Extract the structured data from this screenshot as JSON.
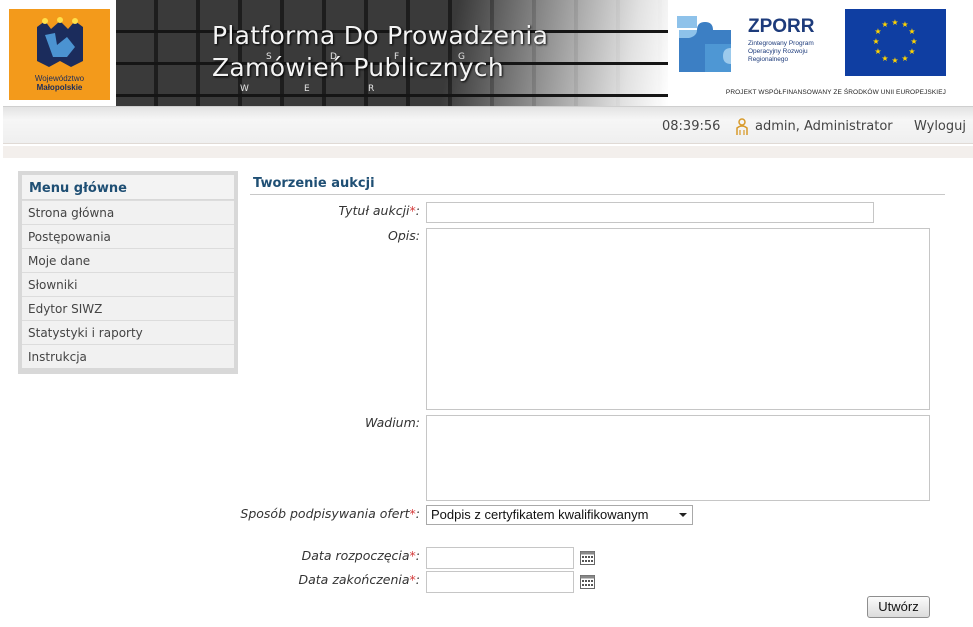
{
  "header": {
    "region_logo_line1": "Województwo",
    "region_logo_line2": "Małopolskie",
    "title_line1": "Platforma Do Prowadzenia",
    "title_line2": "Zamówień Publicznych",
    "zporr_name": "ZPORR",
    "zporr_sub": "Zintegrowany Program Operacyjny Rozwoju Regionalnego",
    "eu_caption": "PROJEKT WSPÓŁFINANSOWANY ZE ŚRODKÓW UNII EUROPEJSKIEJ",
    "keyboard_letters": [
      "W",
      "E",
      "R",
      "S",
      "D",
      "F",
      "G"
    ]
  },
  "userbar": {
    "time": "08:39:56",
    "user": "admin, Administrator",
    "logout_label": "Wyloguj"
  },
  "sidebar": {
    "title": "Menu główne",
    "items": [
      {
        "label": "Strona główna"
      },
      {
        "label": "Postępowania"
      },
      {
        "label": "Moje dane"
      },
      {
        "label": "Słowniki"
      },
      {
        "label": "Edytor SIWZ"
      },
      {
        "label": "Statystyki i raporty"
      },
      {
        "label": "Instrukcja"
      }
    ]
  },
  "form": {
    "title": "Tworzenie aukcji",
    "required_mark": "*",
    "fields": {
      "title_label": "Tytuł aukcji",
      "title_value": "",
      "description_label": "Opis",
      "description_value": "",
      "deposit_label": "Wadium",
      "deposit_value": "",
      "signing_label": "Sposób podpisywania ofert",
      "signing_value": "Podpis z certyfikatem kwalifikowanym",
      "start_label": "Data rozpoczęcia",
      "start_value": "",
      "end_label": "Data zakończenia",
      "end_value": ""
    },
    "submit_label": "Utwórz"
  },
  "colors": {
    "accent": "#1f4f74",
    "required": "#d43a3a",
    "region_logo_bg": "#f39a1b",
    "eu_flag": "#0f3ea2"
  },
  "icons": [
    "region-logo",
    "zporr-logo",
    "eu-flag",
    "user-icon",
    "calendar-icon",
    "dropdown-arrow-icon"
  ]
}
